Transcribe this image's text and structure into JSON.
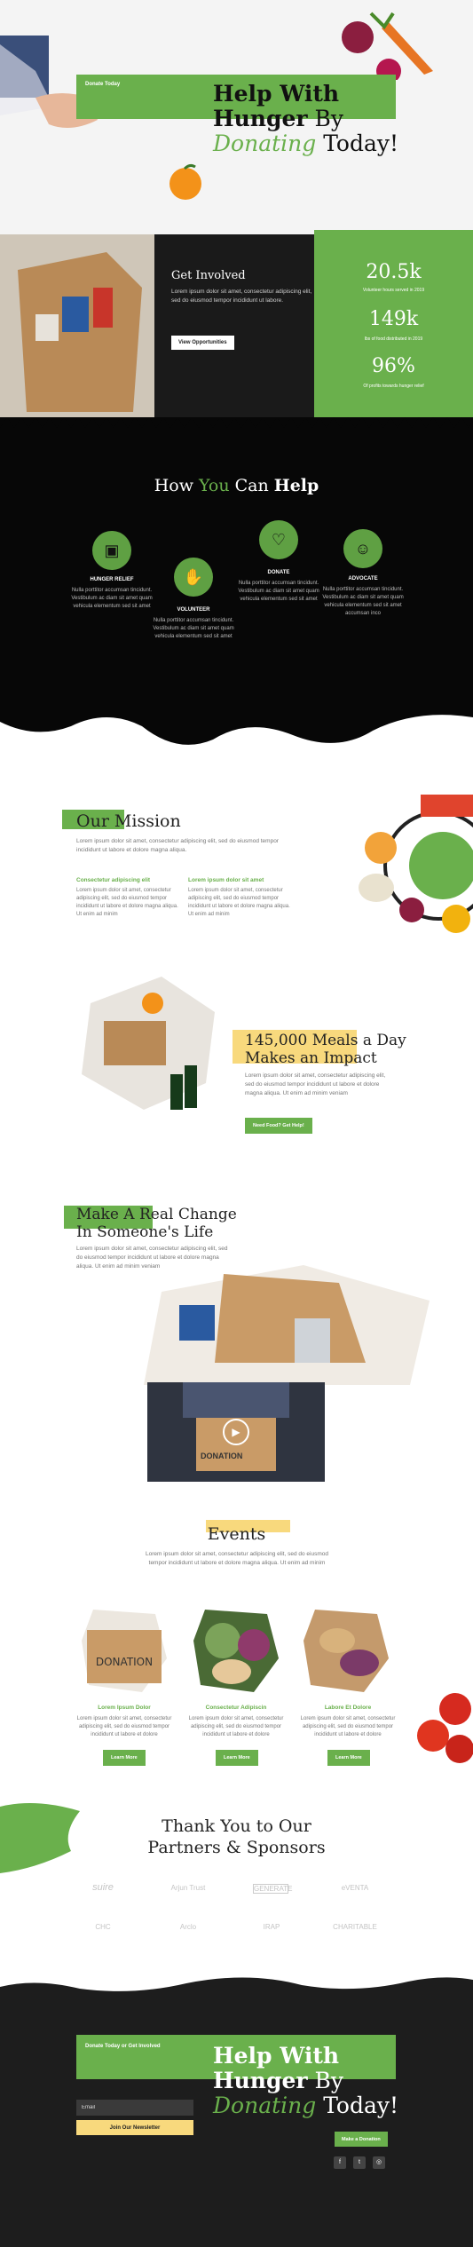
{
  "hero": {
    "tag": "Donate Today",
    "title_line1": "Help With",
    "title_bold2": "Hunger",
    "title_by": " By",
    "title_green": "Donating",
    "title_end": " Today!"
  },
  "get_involved": {
    "title": "Get Involved",
    "text": "Lorem ipsum dolor sit amet, consectetur adipiscing elit, sed do eiusmod tempor incididunt ut labore.",
    "button": "View Opportunities"
  },
  "stats": [
    {
      "value": "20.5k",
      "label": "Volunteer hours served in 2019"
    },
    {
      "value": "149k",
      "label": "lbs of food distributed in 2019"
    },
    {
      "value": "96%",
      "label": "Of profits towards hunger relief"
    }
  ],
  "help": {
    "title_a": "How ",
    "title_you": "You",
    "title_can": " Can ",
    "title_help": "Help",
    "items": [
      {
        "icon": "basket-icon",
        "glyph": "▣",
        "name": "HUNGER RELIEF",
        "text": "Nulla porttitor accumsan tincidunt. Vestibulum ac diam sit amet quam vehicula elementum sed sit amet"
      },
      {
        "icon": "hand-icon",
        "glyph": "✋",
        "name": "VOLUNTEER",
        "text": "Nulla porttitor accumsan tincidunt. Vestibulum ac diam sit amet quam vehicula elementum sed sit amet"
      },
      {
        "icon": "heart-icon",
        "glyph": "♡",
        "name": "DONATE",
        "text": "Nulla porttitor accumsan tincidunt. Vestibulum ac diam sit amet quam vehicula elementum sed sit amet"
      },
      {
        "icon": "people-icon",
        "glyph": "☺",
        "name": "ADVOCATE",
        "text": "Nulla porttitor accumsan tincidunt. Vestibulum ac diam sit amet quam vehicula elementum sed sit amet accumsan inco"
      }
    ]
  },
  "mission": {
    "title": "Our Mission",
    "text": "Lorem ipsum dolor sit amet, consectetur adipiscing elit, sed do eiusmod tempor incididunt ut labore et dolore magna aliqua.",
    "col1_title": "Consectetur adipiscing elit",
    "col1_text": "Lorem ipsum dolor sit amet, consectetur adipiscing elit, sed do eiusmod tempor incididunt ut labore et dolore magna aliqua. Ut enim ad minim",
    "col2_title": "Lorem ipsum dolor sit amet",
    "col2_text": "Lorem ipsum dolor sit amet, consectetur adipiscing elit, sed do eiusmod tempor incididunt ut labore et dolore magna aliqua. Ut enim ad minim"
  },
  "meals": {
    "title_bold": "145,000 Meals",
    "title_rest": " a Day",
    "title_line2": "Makes an Impact",
    "text": "Lorem ipsum dolor sit amet, consectetur adipiscing elit, sed do eiusmod tempor incididunt ut labore et dolore magna aliqua. Ut enim ad minim veniam",
    "button": "Need Food? Get Help!"
  },
  "change": {
    "title_line1": "Make A Real Change",
    "title_line2": "In Someone's Life",
    "text": "Lorem ipsum dolor sit amet, consectetur adipiscing elit, sed do eiusmod tempor incididunt ut labore et dolore magna aliqua. Ut enim ad minim veniam",
    "video_label": "DONATION"
  },
  "events": {
    "title": "Events",
    "text": "Lorem ipsum dolor sit amet, consectetur adipiscing elit, sed do eiusmod tempor incididunt ut labore et dolore magna aliqua. Ut enim ad minim",
    "items": [
      {
        "title": "Lorem Ipsum Dolor",
        "text": "Lorem ipsum dolor sit amet, consectetur adipiscing elit, sed do eiusmod tempor incididunt ut labore et dolore",
        "button": "Learn More",
        "img_label": "DONATION"
      },
      {
        "title": "Consectetur Adipiscin",
        "text": "Lorem ipsum dolor sit amet, consectetur adipiscing elit, sed do eiusmod tempor incididunt ut labore et dolore",
        "button": "Learn More"
      },
      {
        "title": "Labore Et Dolore",
        "text": "Lorem ipsum dolor sit amet, consectetur adipiscing elit, sed do eiusmod tempor incididunt ut labore et dolore",
        "button": "Learn More"
      }
    ]
  },
  "partners": {
    "title_line1": "Thank You to Our",
    "title_line2": "Partners & Sponsors",
    "logos": [
      "suire",
      "Arjun Trust",
      "GENERATE",
      "eVENTA",
      "CHC",
      "Arclo",
      "IRAP",
      "CHARITABLE"
    ]
  },
  "footer": {
    "tag": "Donate Today or Get Involved",
    "title_line1": "Help With",
    "title_bold2": "Hunger",
    "title_by": " By",
    "title_green": "Donating",
    "title_end": " Today!",
    "email_placeholder": "Email",
    "newsletter_button": "Join Our Newsletter",
    "donate_button": "Make a Donation",
    "social": [
      "f",
      "t",
      "◎"
    ]
  },
  "colors": {
    "accent": "#6ab04c",
    "highlight": "#f8d97d",
    "dark": "#070707"
  }
}
